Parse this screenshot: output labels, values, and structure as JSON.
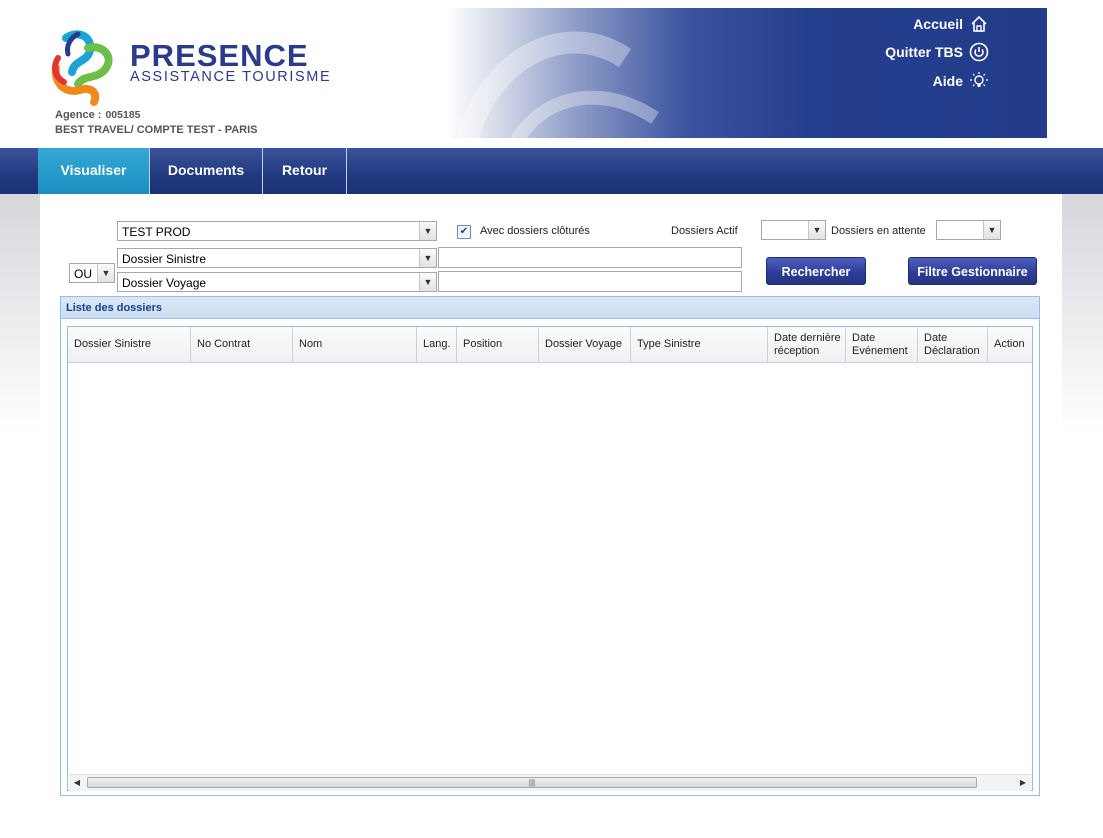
{
  "header": {
    "logo": {
      "word": "PRESENCE",
      "subtitle": "ASSISTANCE TOURISME"
    },
    "agency": {
      "label": "Agence :",
      "code": "005185",
      "name": "BEST TRAVEL/ COMPTE TEST - PARIS"
    },
    "links": {
      "home": "Accueil",
      "quit": "Quitter TBS",
      "help": "Aide"
    }
  },
  "nav": {
    "tabs": [
      "Visualiser",
      "Documents",
      "Retour"
    ],
    "active": "Visualiser"
  },
  "filters": {
    "account_select": "TEST PROD",
    "closed_checkbox": {
      "label": "Avec dossiers clôturés",
      "checked": true
    },
    "active_label": "Dossiers Actif",
    "active_value": "",
    "pending_label": "Dossiers en attente",
    "pending_value": "",
    "operator": "OU",
    "field1": "Dossier Sinistre",
    "field2": "Dossier Voyage",
    "value1": "",
    "value2": ""
  },
  "buttons": {
    "search": "Rechercher",
    "manager_filter": "Filtre Gestionnaire"
  },
  "grid": {
    "title": "Liste des dossiers",
    "columns": [
      "Dossier Sinistre",
      "No Contrat",
      "Nom",
      "Lang.",
      "Position",
      "Dossier Voyage",
      "Type Sinistre",
      "Date dernière réception",
      "Date Evénement",
      "Date Déclaration",
      "Action"
    ],
    "rows": []
  },
  "colors": {
    "brand": "#2a3a8c",
    "nav": "#21397f",
    "active_tab": "#1c8fc0",
    "button": "#2f3d9a"
  }
}
